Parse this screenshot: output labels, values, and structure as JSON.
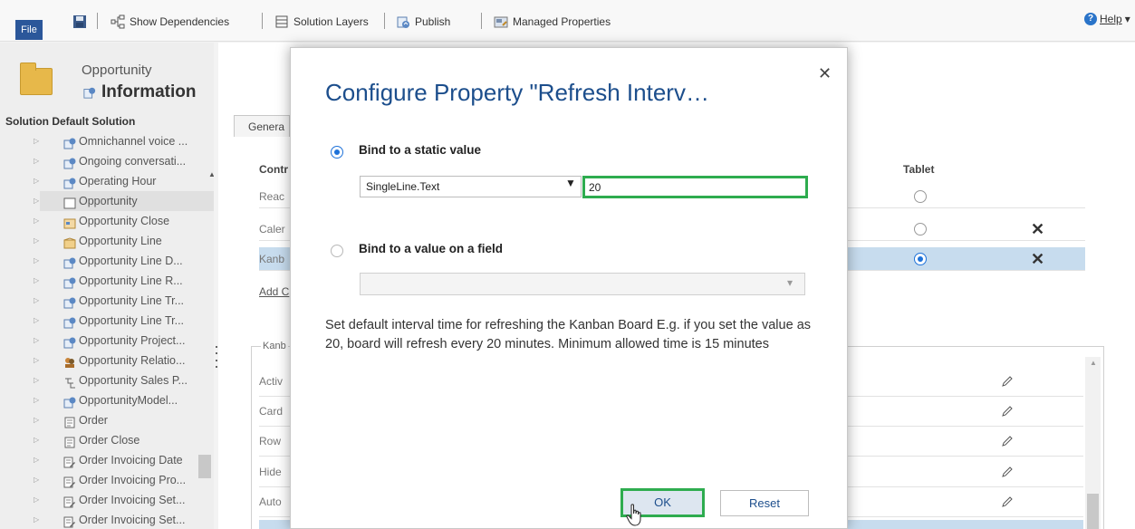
{
  "toolbar": {
    "file_label": "File",
    "save_icon": "save-icon",
    "show_dependencies": "Show Dependencies",
    "solution_layers": "Solution Layers",
    "publish": "Publish",
    "managed_properties": "Managed Properties",
    "help": "Help",
    "help_caret": "▾"
  },
  "leftnav": {
    "entity_name": "Opportunity",
    "entity_sub": "Information",
    "solution_label": "Solution Default Solution",
    "tree": [
      {
        "label": "Omnichannel voice ...",
        "icon": "entity-icon"
      },
      {
        "label": "Ongoing conversati...",
        "icon": "entity-icon"
      },
      {
        "label": "Operating Hour",
        "icon": "entity-icon"
      },
      {
        "label": "Opportunity",
        "icon": "form-icon"
      },
      {
        "label": "Opportunity Close",
        "icon": "calendar-icon"
      },
      {
        "label": "Opportunity Line",
        "icon": "box-icon"
      },
      {
        "label": "Opportunity Line D...",
        "icon": "entity-icon"
      },
      {
        "label": "Opportunity Line R...",
        "icon": "entity-icon"
      },
      {
        "label": "Opportunity Line Tr...",
        "icon": "entity-icon"
      },
      {
        "label": "Opportunity Line Tr...",
        "icon": "entity-icon"
      },
      {
        "label": "Opportunity Project...",
        "icon": "entity-icon"
      },
      {
        "label": "Opportunity Relatio...",
        "icon": "people-icon"
      },
      {
        "label": "Opportunity Sales P...",
        "icon": "flow-icon"
      },
      {
        "label": "OpportunityModel...",
        "icon": "entity-icon"
      },
      {
        "label": "Order",
        "icon": "document-icon"
      },
      {
        "label": "Order Close",
        "icon": "document-icon"
      },
      {
        "label": "Order Invoicing Date",
        "icon": "edit-doc-icon"
      },
      {
        "label": "Order Invoicing Pro...",
        "icon": "edit-doc-icon"
      },
      {
        "label": "Order Invoicing Set...",
        "icon": "edit-doc-icon"
      },
      {
        "label": "Order Invoicing Set...",
        "icon": "edit-doc-icon"
      }
    ]
  },
  "background": {
    "tab_general": "Genera",
    "col_control": "Contr",
    "col_tablet": "Tablet",
    "rows": [
      "Reac",
      "Caler",
      "Kanb"
    ],
    "add_link": "Add C",
    "kanban_label": "Kanb",
    "kanban_rows": [
      "Activ",
      "Card",
      "Row",
      "Hide",
      "Auto"
    ]
  },
  "dialog": {
    "title": "Configure Property \"Refresh Interv…",
    "close": "✕",
    "static_label": "Bind to a static value",
    "type_select_value": "SingleLine.Text",
    "type_select_chevron": "▼",
    "static_value": "20",
    "field_label": "Bind to a value on a field",
    "field_select_chevron": "▾",
    "description": "Set default interval time for refreshing the Kanban Board E.g. if you set the value as 20, board will refresh every 20 minutes. Minimum allowed time is 15 minutes",
    "ok": "OK",
    "reset": "Reset"
  },
  "colors": {
    "accent_blue": "#1c4e8c",
    "highlight_green": "#2eac4f",
    "selected_row": "#c7dcee",
    "file_button": "#2b579a"
  }
}
